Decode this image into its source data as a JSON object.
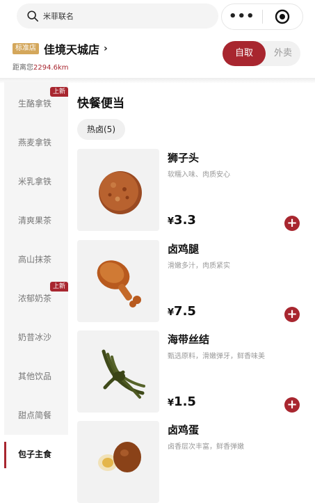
{
  "search": {
    "placeholder": "米菲联名"
  },
  "capsule": {
    "more": "•••"
  },
  "store": {
    "tag": "标准店",
    "name": "佳境天城店",
    "chevron": "›",
    "distance_label": "距离您",
    "distance_value": "2294.6km"
  },
  "mode": {
    "pickup": "自取",
    "delivery": "外卖"
  },
  "sidebar": {
    "items": [
      {
        "label": "生酪拿铁",
        "badge": "上新"
      },
      {
        "label": "燕麦拿铁",
        "badge": ""
      },
      {
        "label": "米乳拿铁",
        "badge": ""
      },
      {
        "label": "清爽果茶",
        "badge": ""
      },
      {
        "label": "高山抹茶",
        "badge": ""
      },
      {
        "label": "浓郁奶茶",
        "badge": "上新"
      },
      {
        "label": "奶昔冰沙",
        "badge": ""
      },
      {
        "label": "其他饮品",
        "badge": ""
      },
      {
        "label": "甜点简餐",
        "badge": ""
      },
      {
        "label": "包子主食",
        "badge": ""
      }
    ],
    "active_index": 9
  },
  "section": {
    "title": "快餐便当",
    "chip": "热卤(5)"
  },
  "products": [
    {
      "name": "狮子头",
      "desc": "软糯入味、肉质安心",
      "currency": "¥",
      "price": "3.3"
    },
    {
      "name": "卤鸡腿",
      "desc": "滑嫩多汁，肉质紧实",
      "currency": "¥",
      "price": "7.5"
    },
    {
      "name": "海带丝结",
      "desc": "甄选原料，滑嫩弹牙，鲜香味美",
      "currency": "¥",
      "price": "1.5"
    },
    {
      "name": "卤鸡蛋",
      "desc": "卤香层次丰富，鲜香弹嫩",
      "currency": "¥",
      "price": ""
    }
  ],
  "colors": {
    "accent": "#a8262f",
    "tag": "#d4a75b"
  }
}
